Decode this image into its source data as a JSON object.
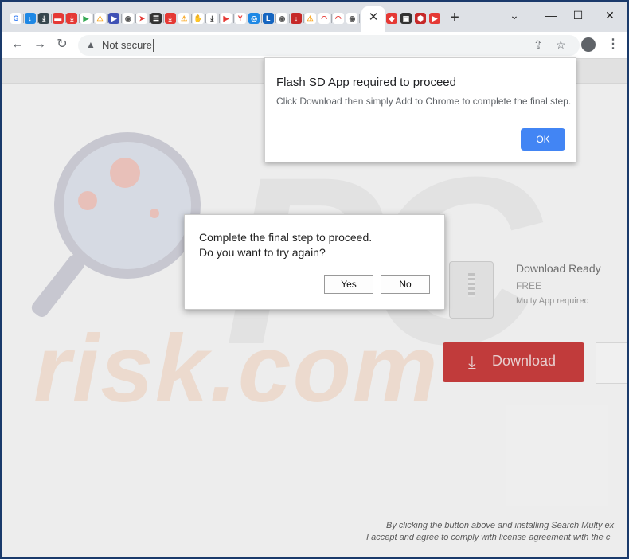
{
  "tabs": {
    "favicons": [
      {
        "name": "google-icon",
        "glyph": "G",
        "color": "#4285f4",
        "bg": "#ffffff"
      },
      {
        "name": "download-cloud-icon",
        "glyph": "↓",
        "color": "#ffffff",
        "bg": "#1e88e5"
      },
      {
        "name": "download-icon",
        "glyph": "⤓",
        "color": "#ffffff",
        "bg": "#37474f"
      },
      {
        "name": "red-app-icon",
        "glyph": "▬",
        "color": "#ffffff",
        "bg": "#e53935"
      },
      {
        "name": "download-red-icon",
        "glyph": "⤓",
        "color": "#ffffff",
        "bg": "#e53935"
      },
      {
        "name": "play-store-icon",
        "glyph": "▶",
        "color": "#34a853",
        "bg": "#ffffff"
      },
      {
        "name": "warning-icon",
        "glyph": "⚠",
        "color": "#f9a825",
        "bg": "#ffffff"
      },
      {
        "name": "media-icon",
        "glyph": "▶",
        "color": "#ffffff",
        "bg": "#3f51b5"
      },
      {
        "name": "globe-icon",
        "glyph": "◉",
        "color": "#555555",
        "bg": "#ffffff"
      },
      {
        "name": "arrow-icon",
        "glyph": "➤",
        "color": "#e53935",
        "bg": "#ffffff"
      },
      {
        "name": "menu-app-icon",
        "glyph": "☰",
        "color": "#ffffff",
        "bg": "#333333"
      },
      {
        "name": "download-red-icon",
        "glyph": "⤓",
        "color": "#ffffff",
        "bg": "#e53935"
      },
      {
        "name": "warning-icon",
        "glyph": "⚠",
        "color": "#f9a825",
        "bg": "#ffffff"
      },
      {
        "name": "hand-icon",
        "glyph": "✋",
        "color": "#f9a825",
        "bg": "#ffffff"
      },
      {
        "name": "download-icon",
        "glyph": "⤓",
        "color": "#333333",
        "bg": "#ffffff"
      },
      {
        "name": "video-icon",
        "glyph": "▶",
        "color": "#e53935",
        "bg": "#ffffff"
      },
      {
        "name": "ym-icon",
        "glyph": "Y",
        "color": "#e53935",
        "bg": "#ffffff"
      },
      {
        "name": "blue-circle-icon",
        "glyph": "◎",
        "color": "#ffffff",
        "bg": "#1e88e5"
      },
      {
        "name": "letter-l-icon",
        "glyph": "L",
        "color": "#ffffff",
        "bg": "#1565c0"
      },
      {
        "name": "globe-icon",
        "glyph": "◉",
        "color": "#555555",
        "bg": "#ffffff"
      },
      {
        "name": "red-download-icon",
        "glyph": "↓",
        "color": "#ffffff",
        "bg": "#c62828"
      },
      {
        "name": "warning-icon",
        "glyph": "⚠",
        "color": "#f9a825",
        "bg": "#ffffff"
      },
      {
        "name": "wifi-icon",
        "glyph": "◠",
        "color": "#e53935",
        "bg": "#ffffff"
      },
      {
        "name": "wifi-icon",
        "glyph": "◠",
        "color": "#e53935",
        "bg": "#ffffff"
      },
      {
        "name": "globe-icon",
        "glyph": "◉",
        "color": "#555555",
        "bg": "#ffffff"
      }
    ],
    "after_active": [
      {
        "name": "shield-red-icon",
        "glyph": "◆",
        "color": "#ffffff",
        "bg": "#e53935"
      },
      {
        "name": "camera-icon",
        "glyph": "▣",
        "color": "#ffffff",
        "bg": "#333333"
      },
      {
        "name": "shield-icon",
        "glyph": "⬢",
        "color": "#ffffff",
        "bg": "#c62828"
      },
      {
        "name": "youtube-icon",
        "glyph": "▶",
        "color": "#ffffff",
        "bg": "#e53935"
      }
    ],
    "close_glyph": "✕",
    "new_tab_glyph": "+"
  },
  "window_controls": {
    "tabsearch": "⌄",
    "minimize": "—",
    "maximize": "☐",
    "close": "✕"
  },
  "toolbar": {
    "back": "←",
    "forward": "→",
    "reload": "↻",
    "security_icon": "▲",
    "security_label": "Not secure",
    "share_icon": "⇪",
    "bookmark_icon": "☆",
    "menu_icon": "⋮"
  },
  "page": {
    "watermark_letters": "PC",
    "watermark_text": "risk.com",
    "download_title": "Download Ready",
    "download_price": "FREE",
    "download_requirement": "Multy App required",
    "download_button_icon": "⤓",
    "download_button": "Download",
    "legal_line1": "By clicking the button above and installing Search Multy ex",
    "legal_line2": "I accept and agree to comply with license agreement with the c"
  },
  "dialog_top": {
    "title": "Flash SD App required to proceed",
    "message": "Click Download then simply Add to Chrome to complete the final step.",
    "ok_label": "OK"
  },
  "dialog_confirm": {
    "line1": "Complete the final step to proceed.",
    "line2": "Do you want to try again?",
    "yes_label": "Yes",
    "no_label": "No"
  }
}
